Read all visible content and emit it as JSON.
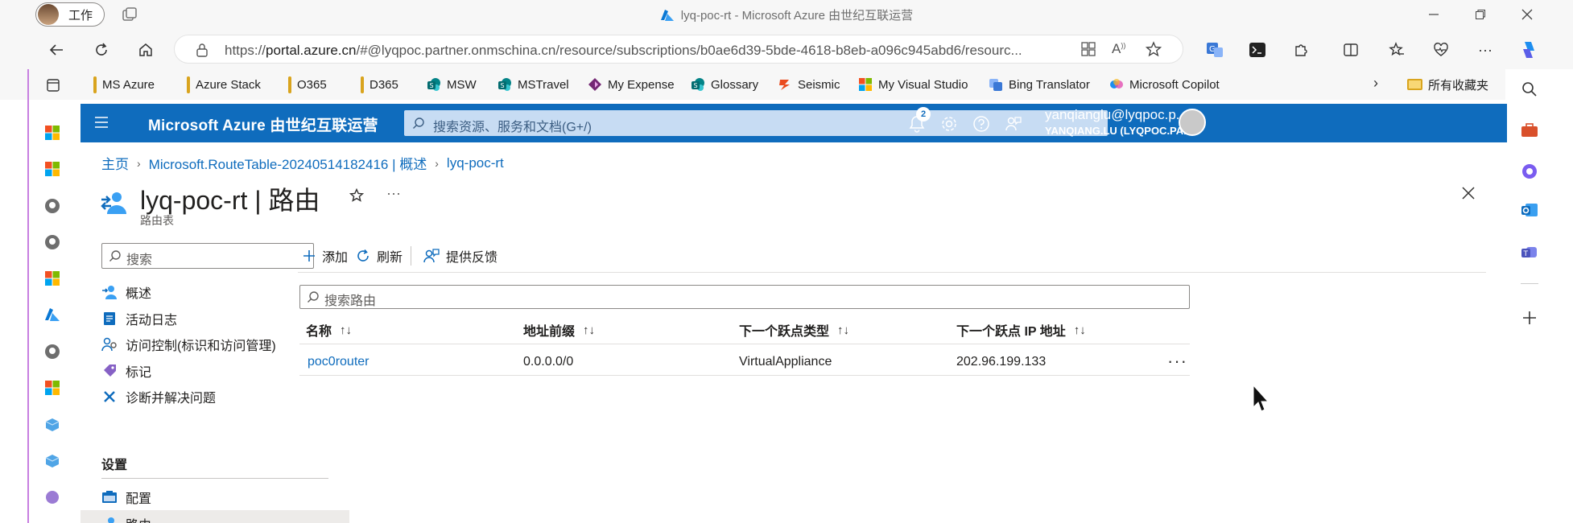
{
  "browser": {
    "profile_label": "工作",
    "window_title": "lyq-poc-rt - Microsoft Azure 由世纪互联运营",
    "url_prefix": "https://",
    "url_host": "portal.azure.cn",
    "url_rest": "/#@lyqpoc.partner.onmschina.cn/resource/subscriptions/b0ae6d39-5bde-4618-b8eb-a096c945abd6/resourc...",
    "favorites": [
      {
        "label": "MS Azure",
        "icon": "folder-icon"
      },
      {
        "label": "Azure Stack",
        "icon": "folder-icon"
      },
      {
        "label": "O365",
        "icon": "folder-icon"
      },
      {
        "label": "D365",
        "icon": "folder-icon"
      },
      {
        "label": "MSW",
        "icon": "sharepoint-icon"
      },
      {
        "label": "MSTravel",
        "icon": "sharepoint-icon"
      },
      {
        "label": "My Expense",
        "icon": "powerapps-icon"
      },
      {
        "label": "Glossary",
        "icon": "sharepoint-icon"
      },
      {
        "label": "Seismic",
        "icon": "seismic-icon"
      },
      {
        "label": "My Visual Studio",
        "icon": "microsoft-icon"
      },
      {
        "label": "Bing Translator",
        "icon": "translator-icon"
      },
      {
        "label": "Microsoft Copilot",
        "icon": "copilot-icon"
      }
    ],
    "all_favorites_label": "所有收藏夹"
  },
  "portal": {
    "brand": "Microsoft Azure 由世纪互联运营",
    "search_placeholder": "搜索资源、服务和文档(G+/)",
    "notification_count": "2",
    "account_email": "yanqianglu@lyqpoc.p...",
    "account_name": "YANQIANG.LU (LYQPOC.PAR...",
    "breadcrumb": [
      "主页",
      "Microsoft.RouteTable-20240514182416 | 概述",
      "lyq-poc-rt"
    ],
    "title": "lyq-poc-rt | 路由",
    "subtitle": "路由表",
    "menu": {
      "search_placeholder": "搜索",
      "items": [
        "概述",
        "活动日志",
        "访问控制(标识和访问管理)",
        "标记",
        "诊断并解决问题"
      ],
      "settings_header": "设置",
      "settings_items": [
        "配置",
        "路由"
      ]
    },
    "commands": {
      "add": "添加",
      "refresh": "刷新",
      "feedback": "提供反馈"
    },
    "route_search_placeholder": "搜索路由",
    "table": {
      "headers": [
        "名称",
        "地址前缀",
        "下一个跃点类型",
        "下一个跃点 IP 地址"
      ],
      "rows": [
        {
          "name": "poc0router",
          "prefix": "0.0.0.0/0",
          "hop_type": "VirtualAppliance",
          "hop_ip": "202.96.199.133"
        }
      ]
    },
    "sort_glyph": "↑↓",
    "more_glyph": "···"
  },
  "colors": {
    "accent": "#0f6cbd",
    "link": "#0f6cbd"
  }
}
